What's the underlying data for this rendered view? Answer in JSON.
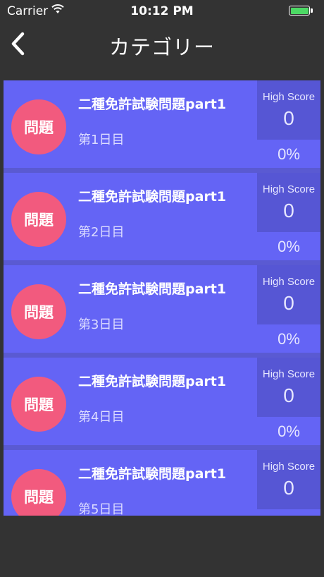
{
  "status_bar": {
    "carrier": "Carrier",
    "time": "10:12 PM"
  },
  "nav": {
    "title": "カテゴリー"
  },
  "colors": {
    "background": "#333333",
    "row": "#6464f5",
    "score_panel": "#5656d4",
    "badge": "#f25a7e",
    "battery": "#4cd964"
  },
  "rows": [
    {
      "badge": "問題",
      "title": "二種免許試験問題part1",
      "subtitle": "第1日目",
      "score_label": "High Score",
      "score": "0",
      "percent": "0%"
    },
    {
      "badge": "問題",
      "title": "二種免許試験問題part1",
      "subtitle": "第2日目",
      "score_label": "High Score",
      "score": "0",
      "percent": "0%"
    },
    {
      "badge": "問題",
      "title": "二種免許試験問題part1",
      "subtitle": "第3日目",
      "score_label": "High Score",
      "score": "0",
      "percent": "0%"
    },
    {
      "badge": "問題",
      "title": "二種免許試験問題part1",
      "subtitle": "第4日目",
      "score_label": "High Score",
      "score": "0",
      "percent": "0%"
    },
    {
      "badge": "問題",
      "title": "二種免許試験問題part1",
      "subtitle": "第5日目",
      "score_label": "High Score",
      "score": "0",
      "percent": ""
    }
  ]
}
